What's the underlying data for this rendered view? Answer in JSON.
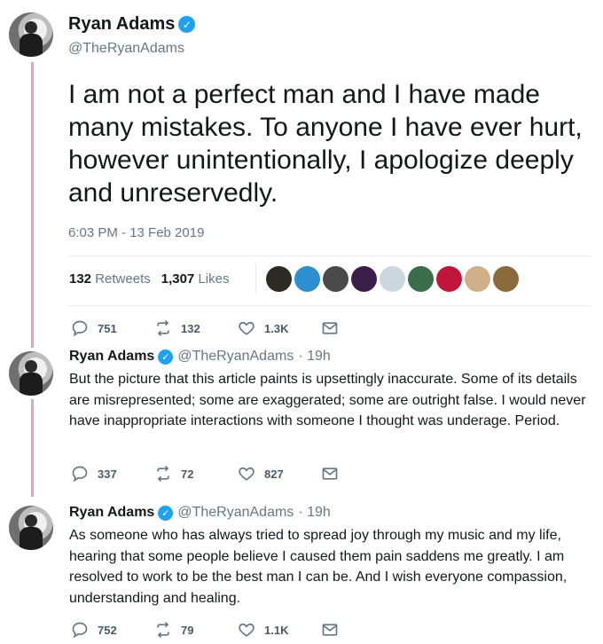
{
  "main_tweet": {
    "author_name": "Ryan Adams",
    "handle": "@TheRyanAdams",
    "text": "I am not a perfect man and I have made many mistakes. To anyone I have ever hurt, however unintentionally, I apologize deeply and unreservedly.",
    "timestamp": "6:03 PM - 13 Feb 2019",
    "retweets_count": "132",
    "retweets_label": "Retweets",
    "likes_count": "1,307",
    "likes_label": "Likes",
    "likers": [
      {
        "icon": "liker-avatar-1",
        "color": "#2b2b22"
      },
      {
        "icon": "liker-avatar-2",
        "color": "#2d8fd0"
      },
      {
        "icon": "liker-avatar-3",
        "color": "#4a4a4a"
      },
      {
        "icon": "liker-avatar-4",
        "color": "#3b1f4a"
      },
      {
        "icon": "liker-avatar-default",
        "color": "#ccd6dd"
      },
      {
        "icon": "liker-avatar-6",
        "color": "#3a6e4a"
      },
      {
        "icon": "liker-avatar-7",
        "color": "#c0163a"
      },
      {
        "icon": "liker-avatar-8",
        "color": "#cdb08a"
      },
      {
        "icon": "liker-avatar-9",
        "color": "#8a6a3a"
      }
    ],
    "actions": {
      "replies": "751",
      "retweets": "132",
      "likes": "1.3K"
    }
  },
  "replies": [
    {
      "author_name": "Ryan Adams",
      "handle": "@TheRyanAdams",
      "time": "· 19h",
      "text": "But the picture that this article paints is upsettingly inaccurate. Some of its details are misrepresented; some are exaggerated; some are outright false. I would never have inappropriate interactions with someone I thought was underage. Period.",
      "actions": {
        "replies": "337",
        "retweets": "72",
        "likes": "827"
      }
    },
    {
      "author_name": "Ryan Adams",
      "handle": "@TheRyanAdams",
      "time": "· 19h",
      "text": "As someone who has always tried to spread joy through my music and my life, hearing that some people believe I caused them pain saddens me greatly. I am resolved to work to be the best man I can be.  And I wish everyone compassion, understanding and healing.",
      "actions": {
        "replies": "752",
        "retweets": "79",
        "likes": "1.1K"
      }
    }
  ],
  "colors": {
    "accent": "#1da1f2",
    "thread_line": "#e8a4ad",
    "muted": "#657786"
  }
}
